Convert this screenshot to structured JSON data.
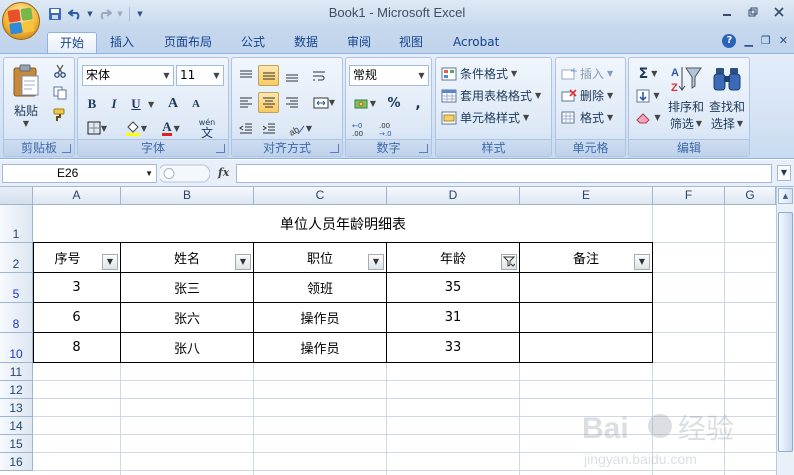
{
  "window": {
    "title": "Book1 - Microsoft Excel"
  },
  "tabs": [
    "开始",
    "插入",
    "页面布局",
    "公式",
    "数据",
    "审阅",
    "视图",
    "Acrobat"
  ],
  "active_tab": "开始",
  "ribbon": {
    "clipboard": {
      "paste_label": "粘贴",
      "group_label": "剪贴板"
    },
    "font": {
      "font_name": "宋体",
      "font_size": "11",
      "group_label": "字体",
      "bold": "B",
      "italic": "I",
      "underline": "U",
      "grow": "A",
      "shrink": "A",
      "font_color_glyph": "A",
      "phonetic": "wén"
    },
    "alignment": {
      "group_label": "对齐方式"
    },
    "number": {
      "format": "常规",
      "percent": "%",
      "comma": ",",
      "group_label": "数字"
    },
    "styles": {
      "conditional": "条件格式",
      "table": "套用表格格式",
      "cell_styles": "单元格样式",
      "group_label": "样式"
    },
    "cells": {
      "insert": "插入",
      "delete": "删除",
      "format": "格式",
      "group_label": "单元格"
    },
    "editing": {
      "sigma": "Σ",
      "sort_filter_line1": "排序和",
      "sort_filter_line2": "筛选",
      "find_line1": "查找和",
      "find_line2": "选择",
      "group_label": "编辑"
    }
  },
  "formula_bar": {
    "name_box": "E26",
    "fx": "fx",
    "formula": ""
  },
  "columns": [
    "A",
    "B",
    "C",
    "D",
    "E",
    "F",
    "G"
  ],
  "row_headers": [
    "1",
    "2",
    "5",
    "8",
    "10",
    "11",
    "12",
    "13",
    "14",
    "15",
    "16"
  ],
  "table": {
    "title": "单位人员年龄明细表",
    "headers": [
      "序号",
      "姓名",
      "职位",
      "年龄",
      "备注"
    ],
    "rows": [
      [
        "3",
        "张三",
        "领班",
        "35",
        ""
      ],
      [
        "6",
        "张六",
        "操作员",
        "31",
        ""
      ],
      [
        "8",
        "张八",
        "操作员",
        "33",
        ""
      ]
    ]
  },
  "colors": {
    "accent": "#15428b",
    "ribbon": "#dbe7f6",
    "filtered_row": "#1a38c4"
  }
}
